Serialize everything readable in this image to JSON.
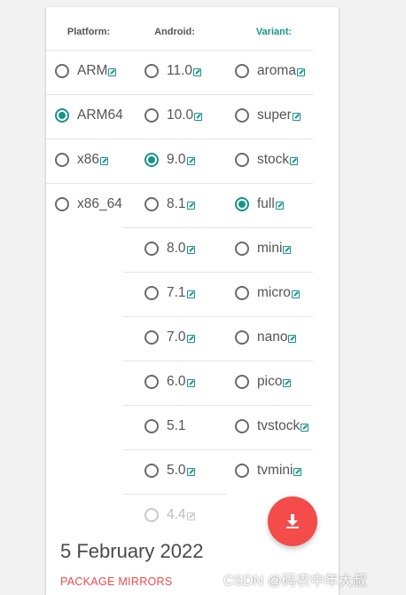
{
  "headers": {
    "platform": "Platform:",
    "android": "Android:",
    "variant": "Variant:"
  },
  "platforms": [
    {
      "label": "ARM",
      "checked": false,
      "ext": true,
      "name": "arm"
    },
    {
      "label": "ARM64",
      "checked": true,
      "ext": false,
      "name": "arm64"
    },
    {
      "label": "x86",
      "checked": false,
      "ext": true,
      "name": "x86"
    },
    {
      "label": "x86_64",
      "checked": false,
      "ext": false,
      "name": "x86-64"
    }
  ],
  "android": [
    {
      "label": "11.0",
      "checked": false,
      "ext": true
    },
    {
      "label": "10.0",
      "checked": false,
      "ext": true
    },
    {
      "label": "9.0",
      "checked": true,
      "ext": true
    },
    {
      "label": "8.1",
      "checked": false,
      "ext": true
    },
    {
      "label": "8.0",
      "checked": false,
      "ext": true
    },
    {
      "label": "7.1",
      "checked": false,
      "ext": true
    },
    {
      "label": "7.0",
      "checked": false,
      "ext": true
    },
    {
      "label": "6.0",
      "checked": false,
      "ext": true
    },
    {
      "label": "5.1",
      "checked": false,
      "ext": false
    },
    {
      "label": "5.0",
      "checked": false,
      "ext": true
    },
    {
      "label": "4.4",
      "checked": false,
      "ext": true,
      "disabled": true
    }
  ],
  "variants": [
    {
      "label": "aroma",
      "checked": false,
      "ext": true
    },
    {
      "label": "super",
      "checked": false,
      "ext": true
    },
    {
      "label": "stock",
      "checked": false,
      "ext": true
    },
    {
      "label": "full",
      "checked": true,
      "ext": true
    },
    {
      "label": "mini",
      "checked": false,
      "ext": true
    },
    {
      "label": "micro",
      "checked": false,
      "ext": true
    },
    {
      "label": "nano",
      "checked": false,
      "ext": true
    },
    {
      "label": "pico",
      "checked": false,
      "ext": true
    },
    {
      "label": "tvstock",
      "checked": false,
      "ext": true
    },
    {
      "label": "tvmini",
      "checked": false,
      "ext": true
    }
  ],
  "footer": {
    "date": "5 February 2022",
    "mirrors": "PACKAGE MIRRORS"
  },
  "download": {
    "icon": "download-icon"
  },
  "watermark": "CSDN @码农中年大叔",
  "colors": {
    "accent": "#159588",
    "fab": "#f44b4b",
    "link": "#f0494a"
  }
}
